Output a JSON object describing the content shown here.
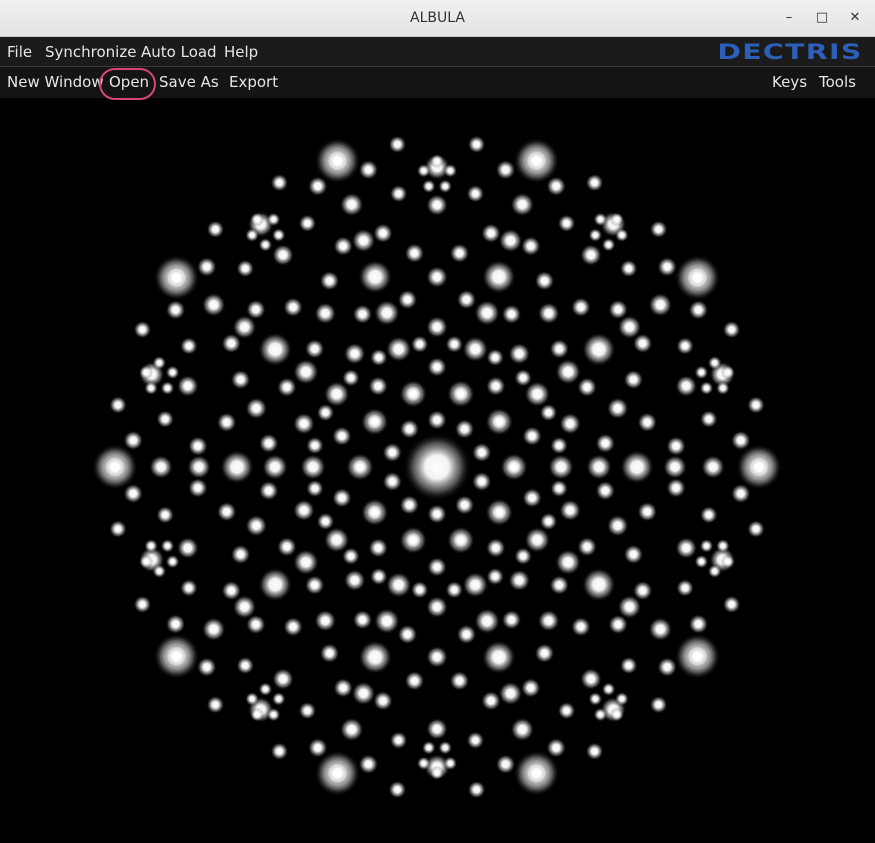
{
  "window": {
    "title": "ALBULA",
    "controls": {
      "minimize": "–",
      "maximize": "□",
      "close": "✕"
    }
  },
  "menu": {
    "file": "File",
    "synchronize": "Synchronize",
    "auto_load": "Auto Load",
    "help": "Help",
    "logo": "DECTRIS"
  },
  "toolbar": {
    "new_window": "New Window",
    "open": "Open",
    "save_as": "Save As",
    "export": "Export",
    "keys": "Keys",
    "tools": "Tools"
  },
  "colors": {
    "logo": "#2c5fb8",
    "highlight": "#d9457a",
    "background": "#000000"
  },
  "image": {
    "description_icon": "decagonal-diffraction-pattern"
  }
}
